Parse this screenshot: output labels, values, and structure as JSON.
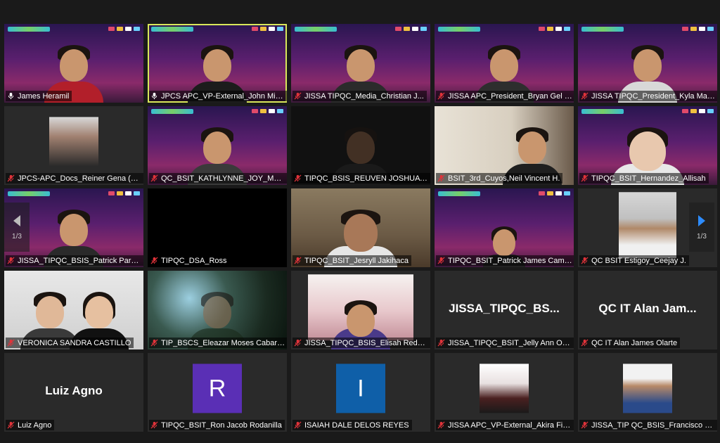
{
  "pagination": {
    "prev": "1/3",
    "next": "1/3"
  },
  "colors": {
    "speaking_outline": "#d9e85a",
    "muted_icon": "#e0333a",
    "nav_next_arrow": "#2d8cff"
  },
  "tiles": [
    {
      "name": "James Heramil",
      "mic": "unmuted"
    },
    {
      "name": "JPCS APC_VP-External_John Mich...",
      "mic": "unmuted",
      "active_speaker": true
    },
    {
      "name": "JISSA TIPQC_Media_Christian J...",
      "mic": "muted"
    },
    {
      "name": "JISSA APC_President_Bryan Gel Fa...",
      "mic": "muted"
    },
    {
      "name": "JISSA TIPQC_President_Kyla Mae ...",
      "mic": "muted"
    },
    {
      "name": "JPCS-APC_Docs_Reiner Gena (he/...",
      "mic": "muted"
    },
    {
      "name": "QC_BSIT_KATHLYNNE_JOY_MORA...",
      "mic": "muted"
    },
    {
      "name": "TIPQC_BSIS_REUVEN JOSHUA SA...",
      "mic": "muted"
    },
    {
      "name": "BSIT_3rd_Cuyos,Neil Vincent H.",
      "mic": "muted"
    },
    {
      "name": "TIPQC_BSIT_Hernandez_Allisah",
      "mic": "muted"
    },
    {
      "name": "JISSA_TIPQC_BSIS_Patrick Parulan",
      "mic": "muted"
    },
    {
      "name": "TIPQC_DSA_Ross",
      "mic": "muted"
    },
    {
      "name": "TIPQC_BSIT_Jesryll Jakihaca",
      "mic": "muted"
    },
    {
      "name": "TIPQC_BSIT_Patrick James Campo",
      "mic": "muted"
    },
    {
      "name": "QC BSIT Estigoy_Ceejay J.",
      "mic": "muted"
    },
    {
      "name": "VERONICA SANDRA CASTILLO",
      "mic": "muted"
    },
    {
      "name": "TIP_BSCS_Eleazar Moses Cabarles",
      "mic": "muted"
    },
    {
      "name": "JISSA_TIPQC_BSIS_Elisah Redonga",
      "mic": "muted"
    },
    {
      "name": "JISSA_TIPQC_BSIT_Jelly Ann Obias",
      "mic": "muted",
      "video_off_name": "JISSA_TIPQC_BS..."
    },
    {
      "name": "QC IT Alan James Olarte",
      "mic": "muted",
      "video_off_name": "QC IT Alan Jam..."
    },
    {
      "name": "Luiz Agno",
      "mic": "muted",
      "video_off_name": "Luiz Agno"
    },
    {
      "name": "TIPQC_BSIT_Ron Jacob Rodanilla",
      "mic": "muted",
      "avatar_letter": "R",
      "avatar_color": "#5a2fb5"
    },
    {
      "name": "ISAIAH DALE DELOS REYES",
      "mic": "muted",
      "avatar_letter": "I",
      "avatar_color": "#0f5fa8"
    },
    {
      "name": "JISSA APC_VP-External_Akira Fidel...",
      "mic": "muted"
    },
    {
      "name": "JISSA_TIP QC_BSIS_Francisco Ron ...",
      "mic": "muted"
    }
  ]
}
